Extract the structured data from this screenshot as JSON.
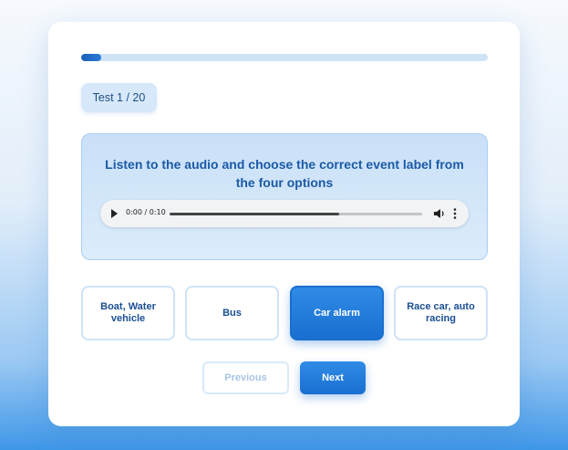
{
  "progress": {
    "current": 1,
    "total": 20,
    "fraction": 0.05
  },
  "counter": {
    "label": "Test 1 / 20"
  },
  "question": {
    "text": "Listen to the audio and choose the correct event label from the four options"
  },
  "audio": {
    "time": "0:00 / 0:10",
    "played_fraction": 0.67,
    "icons": {
      "play": "play-icon",
      "volume": "volume-icon",
      "more": "more-vert-icon"
    }
  },
  "options": [
    {
      "label": "Boat, Water vehicle",
      "selected": false
    },
    {
      "label": "Bus",
      "selected": false
    },
    {
      "label": "Car alarm",
      "selected": true
    },
    {
      "label": "Race car, auto racing",
      "selected": false
    }
  ],
  "nav": {
    "previous_label": "Previous",
    "next_label": "Next",
    "previous_disabled": true
  },
  "colors": {
    "accent": "#1a6fd0",
    "accent_light": "#d6e8fa",
    "text_primary": "#1b5aa6"
  }
}
